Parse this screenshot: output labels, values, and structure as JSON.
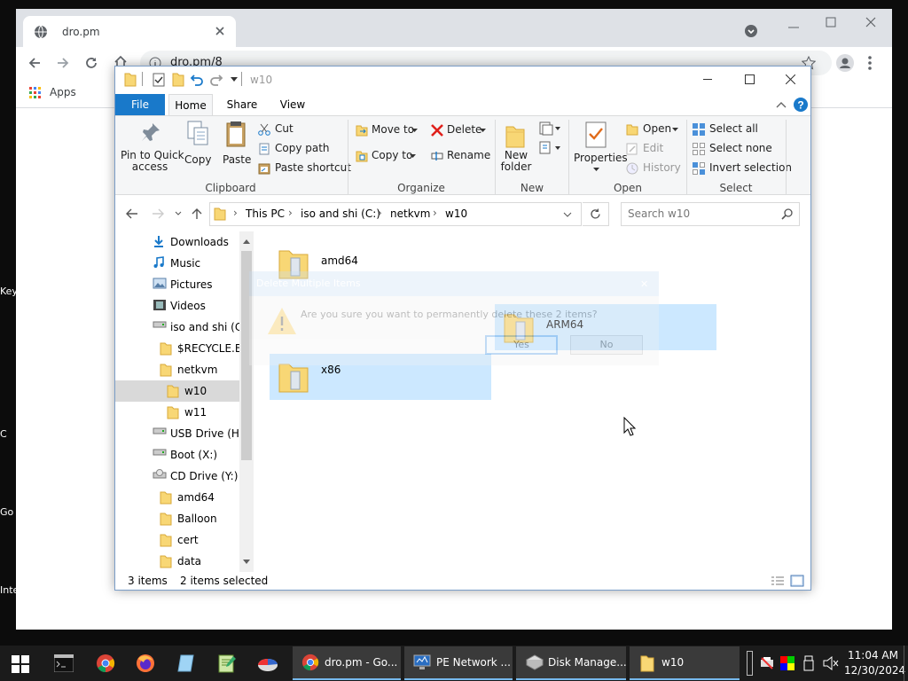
{
  "desktop": {
    "labels": [
      "Key",
      "C",
      "Go",
      "Inte"
    ]
  },
  "browser": {
    "tab_title": "dro.pm",
    "url": "dro.pm/8",
    "bookmarks_apps": "Apps"
  },
  "explorer": {
    "title": "w10",
    "ribbon_tabs": [
      "File",
      "Home",
      "Share",
      "View"
    ],
    "clipboard": {
      "pin": "Pin to Quick access",
      "pin_line1": "Pin to Quick",
      "pin_line2": "access",
      "copy": "Copy",
      "paste": "Paste",
      "cut": "Cut",
      "copy_path": "Copy path",
      "paste_shortcut": "Paste shortcut",
      "group": "Clipboard"
    },
    "organize": {
      "move_to": "Move to",
      "copy_to": "Copy to",
      "delete": "Delete",
      "rename": "Rename",
      "group": "Organize"
    },
    "new": {
      "new_folder_line1": "New",
      "new_folder_line2": "folder",
      "group": "New"
    },
    "open": {
      "properties": "Properties",
      "open": "Open",
      "edit": "Edit",
      "history": "History",
      "group": "Open"
    },
    "select": {
      "select_all": "Select all",
      "select_none": "Select none",
      "invert": "Invert selection",
      "group": "Select"
    },
    "breadcrumb": [
      "This PC",
      "iso and shi (C:)",
      "netkvm",
      "w10"
    ],
    "search_placeholder": "Search w10",
    "nav_items": [
      {
        "label": "Downloads",
        "icon": "download-icon"
      },
      {
        "label": "Music",
        "icon": "music-icon"
      },
      {
        "label": "Pictures",
        "icon": "pictures-icon"
      },
      {
        "label": "Videos",
        "icon": "videos-icon"
      },
      {
        "label": "iso and shi (C:)",
        "icon": "drive-icon"
      },
      {
        "label": "$RECYCLE.BIN",
        "icon": "folder-icon"
      },
      {
        "label": "netkvm",
        "icon": "folder-icon"
      },
      {
        "label": "w10",
        "icon": "folder-icon"
      },
      {
        "label": "w11",
        "icon": "folder-icon"
      },
      {
        "label": "USB Drive (H:)",
        "icon": "drive-icon"
      },
      {
        "label": "Boot (X:)",
        "icon": "drive-icon"
      },
      {
        "label": "CD Drive (Y:) vi",
        "icon": "cd-drive-icon"
      },
      {
        "label": "amd64",
        "icon": "folder-icon"
      },
      {
        "label": "Balloon",
        "icon": "folder-icon"
      },
      {
        "label": "cert",
        "icon": "folder-icon"
      },
      {
        "label": "data",
        "icon": "folder-icon"
      }
    ],
    "files": [
      {
        "name": "amd64",
        "selected": false
      },
      {
        "name": "ARM64",
        "selected": true
      },
      {
        "name": "x86",
        "selected": true
      }
    ],
    "status_count": "3 items",
    "status_selected": "2 items selected"
  },
  "ghost_dialog": {
    "title": "Delete Multiple Items",
    "message": "Are you sure you want to permanently delete these 2 items?",
    "yes": "Yes",
    "no": "No"
  },
  "taskbar": {
    "apps": [
      {
        "label": "dro.pm - Go...",
        "icon": "chrome-icon"
      },
      {
        "label": "PE Network ...",
        "icon": "network-icon"
      },
      {
        "label": "Disk Manage...",
        "icon": "disk-management-icon"
      },
      {
        "label": "w10",
        "icon": "folder-icon"
      }
    ],
    "time": "11:04 AM",
    "date": "12/30/2024"
  },
  "colors": {
    "accent": "#1979ca",
    "selection": "#cce8ff",
    "taskbar": "#1b1b1b",
    "folder": "#f8d775"
  }
}
